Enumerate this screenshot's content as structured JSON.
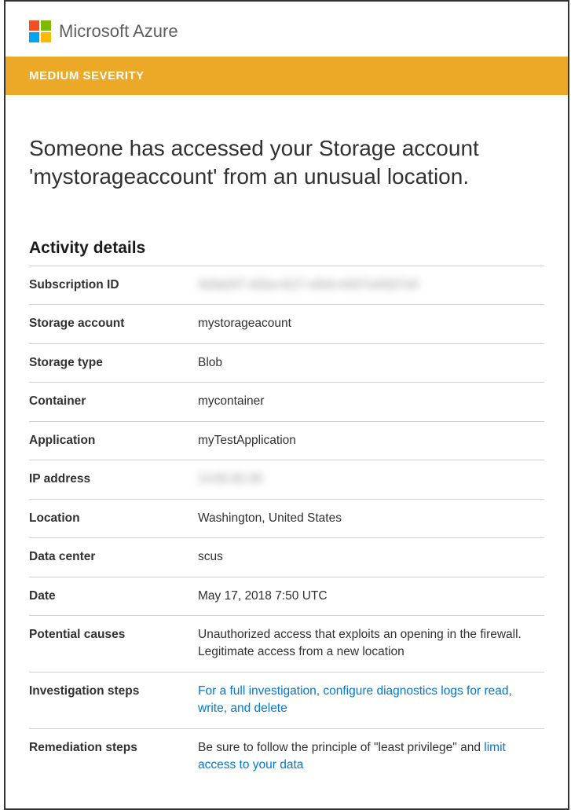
{
  "brand": {
    "name": "Microsoft Azure"
  },
  "severity": {
    "label": "MEDIUM SEVERITY"
  },
  "alert": {
    "title": "Someone has accessed your Storage account 'mystorageaccount' from an unusual location."
  },
  "section": {
    "title": "Activity details"
  },
  "details": {
    "subscription_id": {
      "label": "Subscription ID",
      "value": "3x0a247-x52a-4117-x0x0-x0371x0327x0"
    },
    "storage_account": {
      "label": "Storage account",
      "value": "mystorageacount"
    },
    "storage_type": {
      "label": "Storage type",
      "value": "Blob"
    },
    "container": {
      "label": "Container",
      "value": "mycontainer"
    },
    "application": {
      "label": "Application",
      "value": "myTestApplication"
    },
    "ip_address": {
      "label": "IP address",
      "value": "13.82.82.30"
    },
    "location": {
      "label": "Location",
      "value": "Washington, United States"
    },
    "data_center": {
      "label": "Data center",
      "value": "scus"
    },
    "date": {
      "label": "Date",
      "value": "May 17, 2018 7:50 UTC"
    },
    "potential_causes": {
      "label": "Potential causes",
      "value": "Unauthorized access that exploits an opening in the firewall. Legitimate access from a new location"
    },
    "investigation_steps": {
      "label": "Investigation steps",
      "link_text": "For a full investigation, configure diagnostics logs for read, write, and delete"
    },
    "remediation_steps": {
      "label": "Remediation steps",
      "prefix": "Be sure to follow the principle of \"least privilege\" and ",
      "link_text": "limit access to your data"
    }
  }
}
